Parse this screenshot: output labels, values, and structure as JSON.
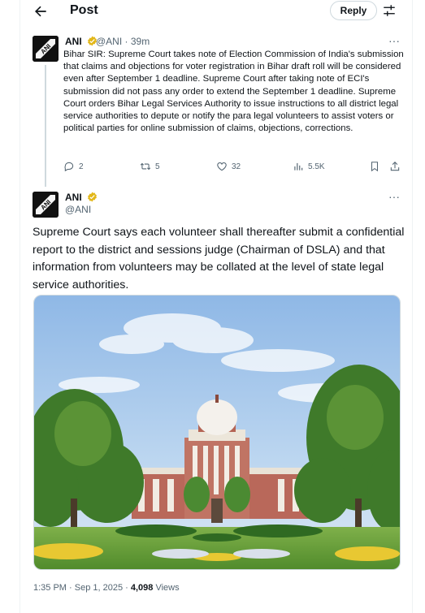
{
  "header": {
    "title": "Post",
    "reply_label": "Reply"
  },
  "parent_tweet": {
    "author_name": "ANI",
    "handle": "@ANI",
    "time": "39m",
    "text": "Bihar SIR: Supreme Court takes note of Election Commission of India's submission that claims and objections for voter registration in Bihar draft roll will be considered even after September 1 deadline. Supreme Court after taking note of ECI's submission did not pass any order to extend the September 1 deadline. Supreme Court orders Bihar Legal Services Authority to issue instructions to all district legal service authorities to depute or notify the para legal volunteers to assist voters or political parties for online submission of claims, objections, corrections.",
    "replies": "2",
    "reposts": "5",
    "likes": "32",
    "views": "5.5K",
    "avatar_text": "ANI"
  },
  "main_tweet": {
    "author_name": "ANI",
    "handle": "@ANI",
    "avatar_text": "ANI",
    "text": "Supreme Court says each volunteer shall thereafter submit a confidential report to the district and sessions judge (Chairman of DSLA) and that information from volunteers may be collated at the level of state legal service authorities.",
    "footer_time": "1:35 PM · Sep 1, 2025 · ",
    "footer_views_count": "4,098",
    "footer_views_label": " Views"
  },
  "colors": {
    "text": "#0f1419",
    "secondary": "#536471",
    "verified_gold": "#e2b719",
    "border": "#cfd9de"
  }
}
